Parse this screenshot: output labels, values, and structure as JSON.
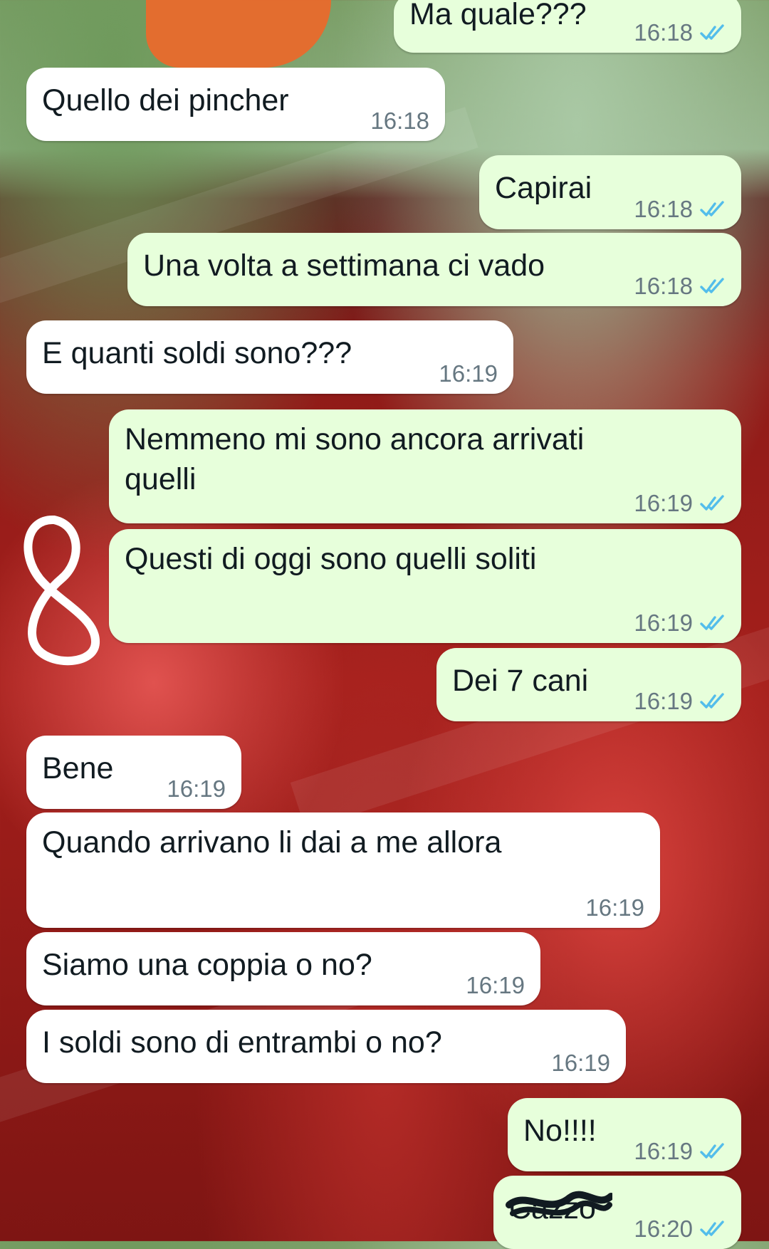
{
  "chat": {
    "messages": [
      {
        "id": "m1",
        "direction": "out",
        "text": "Ma quale???",
        "time": "16:18",
        "status": "read"
      },
      {
        "id": "m2",
        "direction": "in",
        "text": "Quello dei pincher",
        "time": "16:18"
      },
      {
        "id": "m3",
        "direction": "out",
        "text": "Capirai",
        "time": "16:18",
        "status": "read"
      },
      {
        "id": "m4",
        "direction": "out",
        "text": "Una volta a settimana ci vado",
        "time": "16:18",
        "status": "read"
      },
      {
        "id": "m5",
        "direction": "in",
        "text": "E quanti soldi sono???",
        "time": "16:19"
      },
      {
        "id": "m6",
        "direction": "out",
        "text": "Nemmeno mi sono ancora arrivati\nquelli",
        "time": "16:19",
        "status": "read"
      },
      {
        "id": "m7",
        "direction": "out",
        "text": "Questi di oggi sono quelli soliti",
        "time": "16:19",
        "status": "read"
      },
      {
        "id": "m8",
        "direction": "out",
        "text": "Dei 7 cani",
        "time": "16:19",
        "status": "read"
      },
      {
        "id": "m9",
        "direction": "in",
        "text": "Bene",
        "time": "16:19"
      },
      {
        "id": "m10",
        "direction": "in",
        "text": "Quando arrivano li dai a me allora",
        "time": "16:19"
      },
      {
        "id": "m11",
        "direction": "in",
        "text": "Siamo una coppia o no?",
        "time": "16:19"
      },
      {
        "id": "m12",
        "direction": "in",
        "text": "I soldi sono di entrambi o no?",
        "time": "16:19"
      },
      {
        "id": "m13",
        "direction": "out",
        "text": "No!!!!",
        "time": "16:19",
        "status": "read"
      },
      {
        "id": "m14",
        "direction": "out",
        "text": "Cazzo",
        "time": "16:20",
        "status": "read",
        "redacted": true
      }
    ]
  },
  "colors": {
    "outgoing_bubble": "#e7ffdb",
    "incoming_bubble": "#ffffff",
    "read_ticks": "#53bdeb",
    "meta_text": "#667781"
  },
  "icons": {
    "read_receipt": "double-check-icon"
  }
}
